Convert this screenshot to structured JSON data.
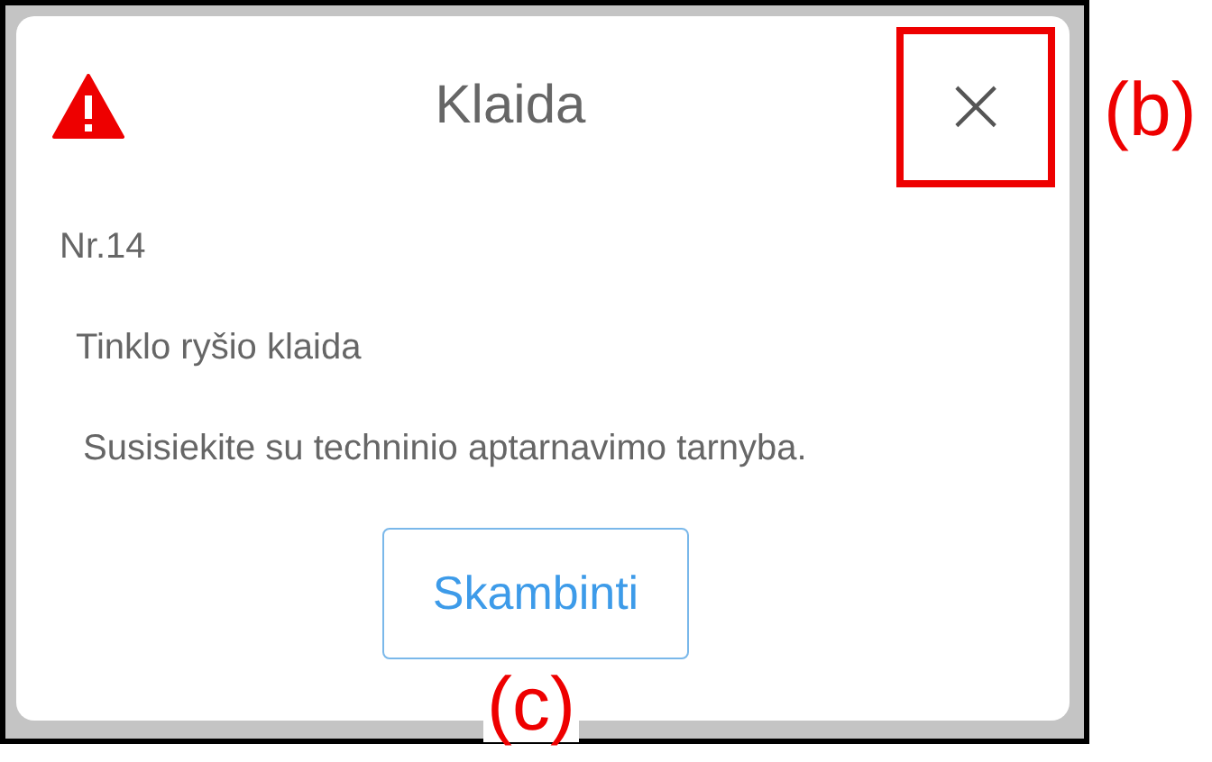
{
  "dialog": {
    "title": "Klaida",
    "close_symbol": "×",
    "number": "Nr.14",
    "message": "Tinklo ryšio klaida",
    "detail": "Susisiekite su techninio aptarnavimo tarnyba.",
    "button": "Skambinti"
  },
  "annotations": [
    {
      "label": "(b)",
      "kind": "close"
    },
    {
      "label": "(c)",
      "kind": "button"
    }
  ]
}
